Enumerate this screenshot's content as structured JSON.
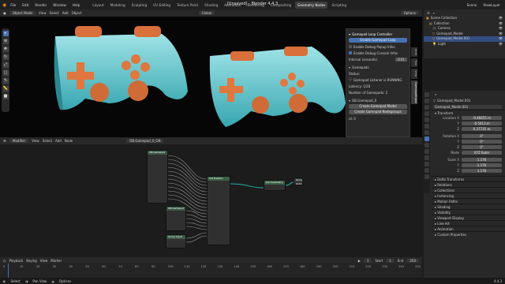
{
  "window": {
    "title": "[Unsaved] - Blender 4.4.3"
  },
  "menu": [
    "File",
    "Edit",
    "Render",
    "Window",
    "Help"
  ],
  "workspaces": [
    "Layout",
    "Modeling",
    "Sculpting",
    "UV Editing",
    "Texture Paint",
    "Shading",
    "Animation",
    "Rendering",
    "Compositing",
    "Geometry Nodes",
    "Scripting"
  ],
  "active_workspace": "Geometry Nodes",
  "scene": {
    "label": "Scene",
    "view_layer": "ViewLayer"
  },
  "viewport": {
    "mode": "Object Mode",
    "menus": [
      "View",
      "Select",
      "Add",
      "Object"
    ],
    "transform": "Global",
    "options": "Options"
  },
  "npanel": {
    "header": "Gamepad Loop Controller",
    "enable_btn": "Enable Gamepad Loop",
    "checks": [
      "Enable Debug Popup Infos",
      "Enable Debug Console Infos"
    ],
    "interval_label": "Interval (seconds)",
    "interval_value": "0.01",
    "section": "Gamepads",
    "status_label": "Status:",
    "status_value": "Gamepad Listener is RUNNING",
    "latency": "Latency: 1/28",
    "num": "Number of Gamepads: 2",
    "gp_name": "OB.Gamepad_0",
    "btn1": "Create Gamepad Model",
    "btn2": "Create Gamepad Nodegroups",
    "idx": "id: 0"
  },
  "sidebar_tabs": [
    "Item",
    "Tool",
    "View",
    "GamepadInput"
  ],
  "node_editor": {
    "type": "Modifier",
    "menus": [
      "View",
      "Select",
      "Add",
      "Node"
    ],
    "group": "OB.Gamepad_0_GN",
    "object": "Gamepad_Model.001",
    "modifier": "geometry",
    "breadcrumb": "OB.Gamepad_0_GN"
  },
  "nodes": {
    "input_title": "OB.Gamepad",
    "group_title": "Group Input",
    "join": "Join Geometry",
    "out": "Group Output",
    "set": "Set Position"
  },
  "timeline": {
    "menus": [
      "Playback",
      "Keying",
      "View",
      "Marker"
    ],
    "frame": "1",
    "start_label": "Start",
    "start": "1",
    "end_label": "End",
    "end": "250",
    "ticks": [
      "0",
      "10",
      "20",
      "30",
      "40",
      "50",
      "60",
      "70",
      "80",
      "90",
      "100",
      "110",
      "120",
      "130",
      "140",
      "150",
      "160",
      "170",
      "180",
      "190",
      "200",
      "210",
      "220",
      "230",
      "240",
      "250"
    ]
  },
  "outliner": {
    "rows": [
      {
        "name": "Scene Collection",
        "sel": false
      },
      {
        "name": "Collection",
        "sel": false
      },
      {
        "name": "Camera",
        "sel": false
      },
      {
        "name": "Gamepad_Model",
        "sel": false
      },
      {
        "name": "Gamepad_Model.001",
        "sel": true
      },
      {
        "name": "Light",
        "sel": false
      }
    ]
  },
  "properties": {
    "object": "Gamepad_Model.001",
    "data_name": "Gamepad_Model.001",
    "transform": "Transform",
    "location": {
      "label": "Location X",
      "x": "-0.48455 m",
      "y": "-0.5413 m",
      "z": "0.37735 m"
    },
    "rotation": {
      "label": "Rotation X",
      "x": "0°",
      "y": "0°",
      "z": "0°"
    },
    "mode_label": "Mode",
    "mode": "XYZ Euler",
    "scale": {
      "label": "Scale X",
      "x": "1.176",
      "y": "1.176",
      "z": "1.176"
    },
    "sections": [
      "Delta Transforms",
      "Relations",
      "Collections",
      "Instancing",
      "Motion Paths",
      "Shading",
      "Visibility",
      "Viewport Display",
      "Line Art",
      "Animation",
      "Custom Properties"
    ]
  },
  "status": {
    "select": "Select",
    "pan": "Pan View",
    "options": "Options",
    "version": "4.4.3"
  }
}
